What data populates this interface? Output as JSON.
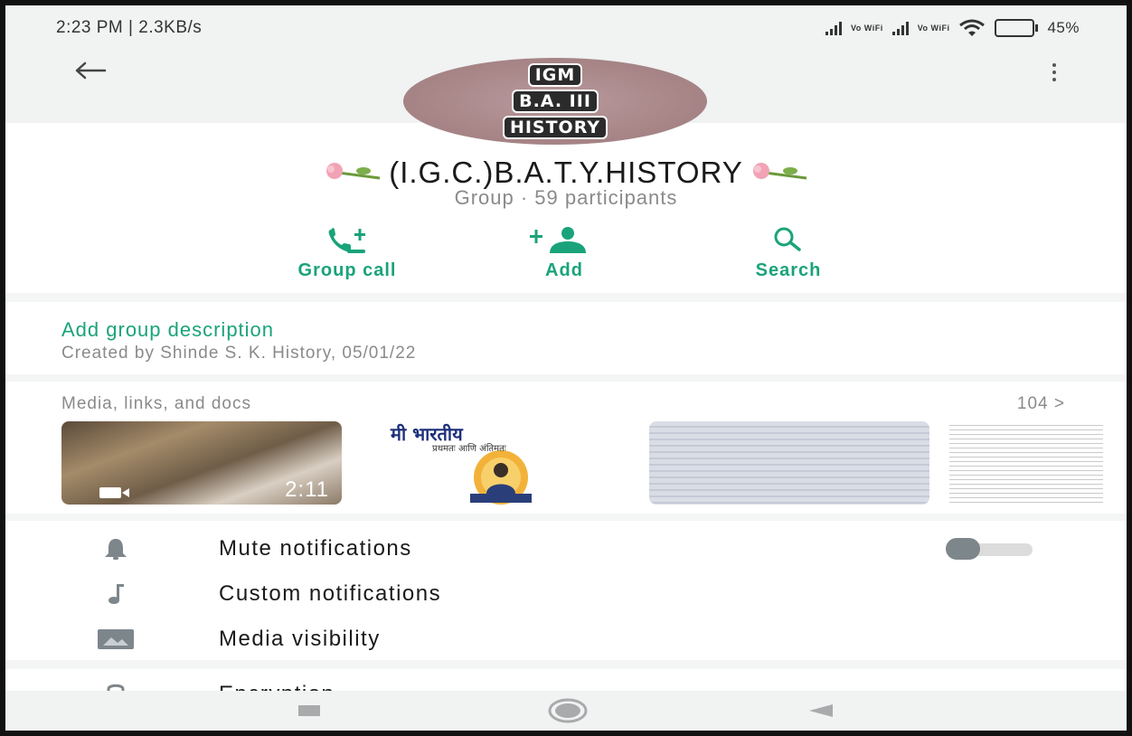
{
  "status_bar": {
    "time_speed": "2:23 PM | 2.3KB/s",
    "sim_badge": "Vo WiFi",
    "battery_percent": "45%",
    "battery_level": 0.45
  },
  "header": {
    "back_icon": "arrow-left-icon",
    "menu_icon": "more-vert-icon"
  },
  "avatar_lines": [
    "IGM",
    "B.A. III",
    "HISTORY"
  ],
  "group": {
    "name": "(I.G.C.)B.A.T.Y.HISTORY",
    "meta": "Group · 59 participants"
  },
  "actions": [
    {
      "label": "Group call",
      "icon": "phone-add-icon"
    },
    {
      "label": "Add",
      "icon": "person-add-icon"
    },
    {
      "label": "Search",
      "icon": "search-icon"
    }
  ],
  "description": {
    "add_label": "Add group description",
    "created": "Created by Shinde S. K. History, 05/01/22"
  },
  "media": {
    "title": "Media, links, and docs",
    "count": "104 >",
    "video_duration": "2:11",
    "poster_heading": "मी भारतीय",
    "poster_sub": "प्रथमतः आणि अंतिमतः"
  },
  "settings": [
    {
      "label": "Mute notifications",
      "icon": "bell-icon"
    },
    {
      "label": "Custom notifications",
      "icon": "music-note-icon"
    },
    {
      "label": "Media visibility",
      "icon": "image-icon"
    }
  ],
  "encryption": {
    "label": "Encryption",
    "icon": "lock-icon"
  },
  "colors": {
    "accent": "#1aa37a"
  }
}
